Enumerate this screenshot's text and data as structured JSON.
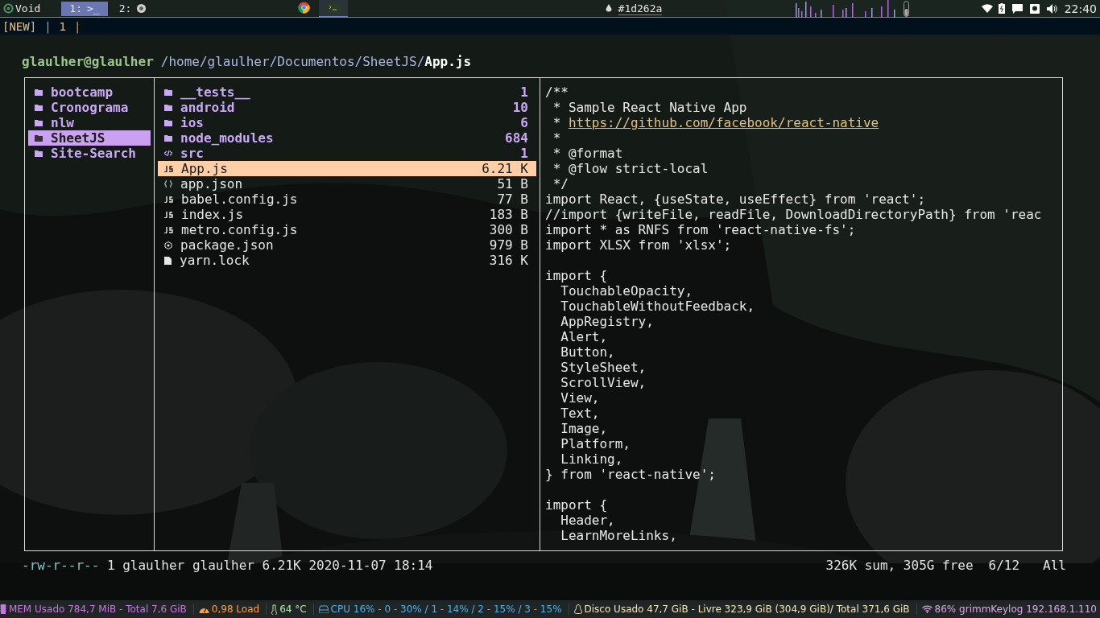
{
  "topbar": {
    "logo": "Void",
    "workspaces": [
      {
        "label": "1:",
        "glyph": ">_",
        "selected": true
      },
      {
        "label": "2:",
        "kind": "browser",
        "selected": false
      }
    ],
    "tasks": [
      {
        "kind": "browser",
        "selected": false
      },
      {
        "kind": "terminal",
        "selected": true
      }
    ],
    "color_value": "#1d262a",
    "clock": "22:40"
  },
  "tmux": [
    {
      "kind": "tag",
      "text": "[NEW]"
    },
    {
      "kind": "separator",
      "text": "|"
    },
    {
      "kind": "window",
      "text": "1"
    },
    {
      "kind": "separator",
      "text": "|"
    }
  ],
  "ranger": {
    "user": "glaulher@glaulher",
    "dir": "/home/glaulher/Documentos/SheetJS/",
    "file": "App.js",
    "parents": [
      {
        "name": "bootcamp",
        "selected": false
      },
      {
        "name": "Cronograma",
        "selected": false
      },
      {
        "name": "nlw",
        "selected": false
      },
      {
        "name": "SheetJS",
        "selected": true
      },
      {
        "name": "Site-Search",
        "selected": false
      }
    ],
    "files": [
      {
        "kind": "dir",
        "name": "__tests__",
        "size": "1",
        "selected": false
      },
      {
        "kind": "dir",
        "name": "android",
        "size": "10",
        "selected": false
      },
      {
        "kind": "dir",
        "name": "ios",
        "size": "6",
        "selected": false
      },
      {
        "kind": "dir",
        "name": "node_modules",
        "size": "684",
        "selected": false
      },
      {
        "kind": "code",
        "name": "src",
        "size": "1",
        "selected": false
      },
      {
        "kind": "js",
        "name": "App.js",
        "size": "6.21 K",
        "selected": true
      },
      {
        "kind": "json",
        "name": "app.json",
        "size": "51 B",
        "selected": false
      },
      {
        "kind": "js",
        "name": "babel.config.js",
        "size": "77 B",
        "selected": false
      },
      {
        "kind": "js",
        "name": "index.js",
        "size": "183 B",
        "selected": false
      },
      {
        "kind": "js",
        "name": "metro.config.js",
        "size": "300 B",
        "selected": false
      },
      {
        "kind": "node",
        "name": "package.json",
        "size": "979 B",
        "selected": false
      },
      {
        "kind": "file",
        "name": "yarn.lock",
        "size": "316 K",
        "selected": false
      }
    ],
    "preview": [
      {
        "text": "/**"
      },
      {
        "text": " * Sample React Native App"
      },
      {
        "text": " * ",
        "link": "https://github.com/facebook/react-native"
      },
      {
        "text": " *"
      },
      {
        "text": " * @format"
      },
      {
        "text": " * @flow strict-local"
      },
      {
        "text": " */"
      },
      {
        "text": "import React, {useState, useEffect} from 'react';"
      },
      {
        "text": "//import {writeFile, readFile, DownloadDirectoryPath} from 'reac"
      },
      {
        "text": "import * as RNFS from 'react-native-fs';"
      },
      {
        "text": "import XLSX from 'xlsx';"
      },
      {
        "text": "import {",
        "blank_before": true
      },
      {
        "text": "  TouchableOpacity,"
      },
      {
        "text": "  TouchableWithoutFeedback,"
      },
      {
        "text": "  AppRegistry,"
      },
      {
        "text": "  Alert,"
      },
      {
        "text": "  Button,"
      },
      {
        "text": "  StyleSheet,"
      },
      {
        "text": "  ScrollView,"
      },
      {
        "text": "  View,"
      },
      {
        "text": "  Text,"
      },
      {
        "text": "  Image,"
      },
      {
        "text": "  Platform,"
      },
      {
        "text": "  Linking,"
      },
      {
        "text": "} from 'react-native';"
      },
      {
        "text": "import {",
        "blank_before": true
      },
      {
        "text": "  Header,"
      },
      {
        "text": "  LearnMoreLinks,"
      }
    ],
    "status": {
      "perms": "-rw-r--r--",
      "info": "1 glaulher glaulher 6.21K 2020-11-07 18:14",
      "sum": "326K sum, 305G free",
      "position": "6/12",
      "scroll": "All"
    }
  },
  "bottombar": [
    {
      "kind": "mem",
      "text": "MEM Usado 784,7 MiB - Total 7,6 GiB",
      "color": "#c678dd"
    },
    {
      "kind": "load",
      "text": "0,98 Load",
      "color": "#ff9e3b"
    },
    {
      "kind": "temp",
      "text": "64 °C",
      "color": "#b5e8a0"
    },
    {
      "kind": "cpu",
      "text": "CPU 16% - 0 - 30% / 1 - 14% / 2 - 15% / 3 - 15%",
      "color": "#4fb3e8"
    },
    {
      "kind": "disk",
      "text": "Disco Usado 47,7 GiB - Livre 323,9 GiB (304,9 GiB)/ Total 371,6 GiB",
      "color": "#f0e6b8"
    },
    {
      "kind": "wifi",
      "text": "86% grimmKeylog 192.168.1.110",
      "color": "#d7a8e0"
    }
  ]
}
